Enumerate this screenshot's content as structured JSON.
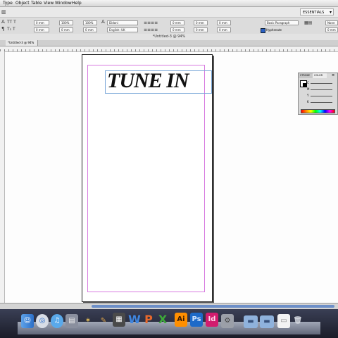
{
  "menubar": {
    "items": [
      "Type",
      "Object",
      "Table",
      "View",
      "Window",
      "Help"
    ]
  },
  "appbar": {
    "workspace": "ESSENTIALS"
  },
  "control": {
    "font_family": "Didoni",
    "font_style": "Bold",
    "font_size": "100%",
    "tracking": "100%",
    "language": "English: UK",
    "paragraph_style": "Basic Paragraph",
    "hyphenate": "Hyphenate",
    "fields": [
      "0 mm",
      "0 mm",
      "0 mm",
      "0 mm",
      "0 mm",
      "0 mm",
      "0 mm",
      "0 mm"
    ],
    "none_label": "None"
  },
  "document": {
    "tab_label": "*Untitled-3 @ 94%",
    "window_title": "*Untitled-3 @ 94%",
    "headline": "TUNE IN"
  },
  "swatches": {
    "tabs": [
      "STROKE",
      "COLOR"
    ],
    "rows": [
      "C",
      "M",
      "Y",
      "K"
    ]
  },
  "dock": {
    "icons": [
      "finder-icon",
      "dashboard-icon",
      "itunes-icon",
      "calendar-icon",
      "directory-utility-icon",
      "app-icon",
      "word-icon",
      "powerpoint-icon",
      "excel-icon",
      "illustrator-icon",
      "photoshop-icon",
      "indesign-icon",
      "system-preferences-icon",
      "folder-icon",
      "folder-icon-2",
      "document-icon",
      "trash-icon"
    ],
    "labels": {
      "ai": "Ai",
      "ps": "Ps",
      "id": "Id",
      "word": "W",
      "ppt": "P",
      "xl": "X"
    }
  },
  "colors": {
    "accent": "#d87be0",
    "frame": "#7aa7d8",
    "illustrator": "#ff8f00",
    "photoshop": "#1e6ac8",
    "indesign": "#d21c6e"
  }
}
